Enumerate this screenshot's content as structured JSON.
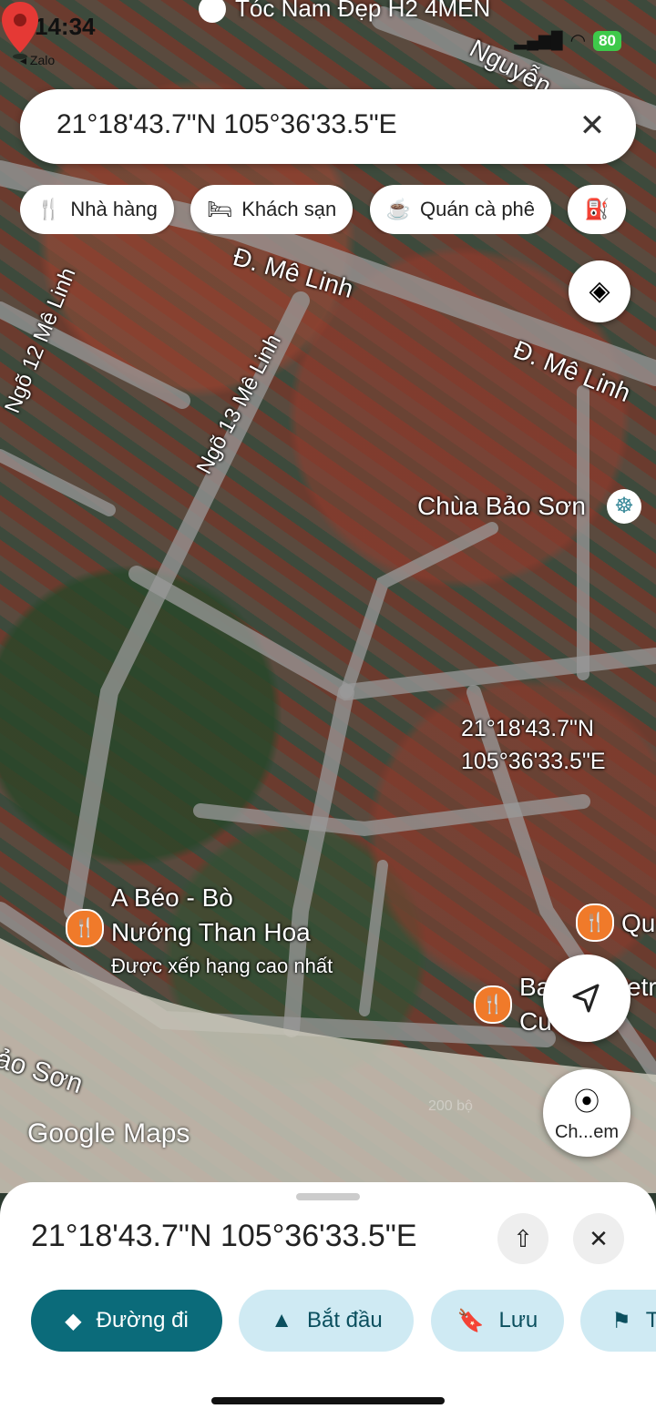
{
  "status_bar": {
    "time": "14:34",
    "back_app": "◂ Zalo",
    "battery": "80"
  },
  "top_place": "Tóc Nam Đẹp H2 4MEN",
  "search": {
    "query": "21°18'43.7\"N 105°36'33.5\"E",
    "clear_icon": "close-icon"
  },
  "chips": [
    {
      "label": "Nhà hàng",
      "icon": "restaurant-icon"
    },
    {
      "label": "Khách sạn",
      "icon": "hotel-icon"
    },
    {
      "label": "Quán cà phê",
      "icon": "cafe-icon"
    }
  ],
  "map_labels": {
    "road_top_right": "Nguyễn",
    "road_me_linh_1": "Đ. Mê Linh",
    "road_me_linh_2": "Đ. Mê Linh",
    "alley_12": "Ngõ 12 Mê Linh",
    "alley_13": "Ngõ 13 Mê Linh",
    "temple": "Chùa Bảo Sơn",
    "pin_line1": "21°18'43.7\"N",
    "pin_line2": "105°36'33.5\"E",
    "restaurant_name_1": "A Béo - Bò",
    "restaurant_name_2": "Nướng Than Hoa",
    "restaurant_rating": "Được xếp hạng cao nhất",
    "poi_right_1": "Qu",
    "poi_right_2a": "Ba",
    "poi_right_2b": "etr",
    "poi_right_2c": "Cu",
    "lake": "ảo Sơn",
    "scale": "200 bộ"
  },
  "watermark": "Google Maps",
  "fabs": {
    "explore_label": "Ch...em"
  },
  "sheet": {
    "title": "21°18'43.7\"N 105°36'33.5\"E",
    "actions": [
      {
        "label": "Đường đi",
        "icon": "directions-icon",
        "primary": true
      },
      {
        "label": "Bắt đầu",
        "icon": "navigate-icon",
        "primary": false
      },
      {
        "label": "Lưu",
        "icon": "bookmark-icon",
        "primary": false
      },
      {
        "label": "T",
        "icon": "flag-icon",
        "primary": false
      }
    ]
  },
  "colors": {
    "accent": "#0b6b7a",
    "pin": "#e53935",
    "poi": "#f07a2a"
  }
}
